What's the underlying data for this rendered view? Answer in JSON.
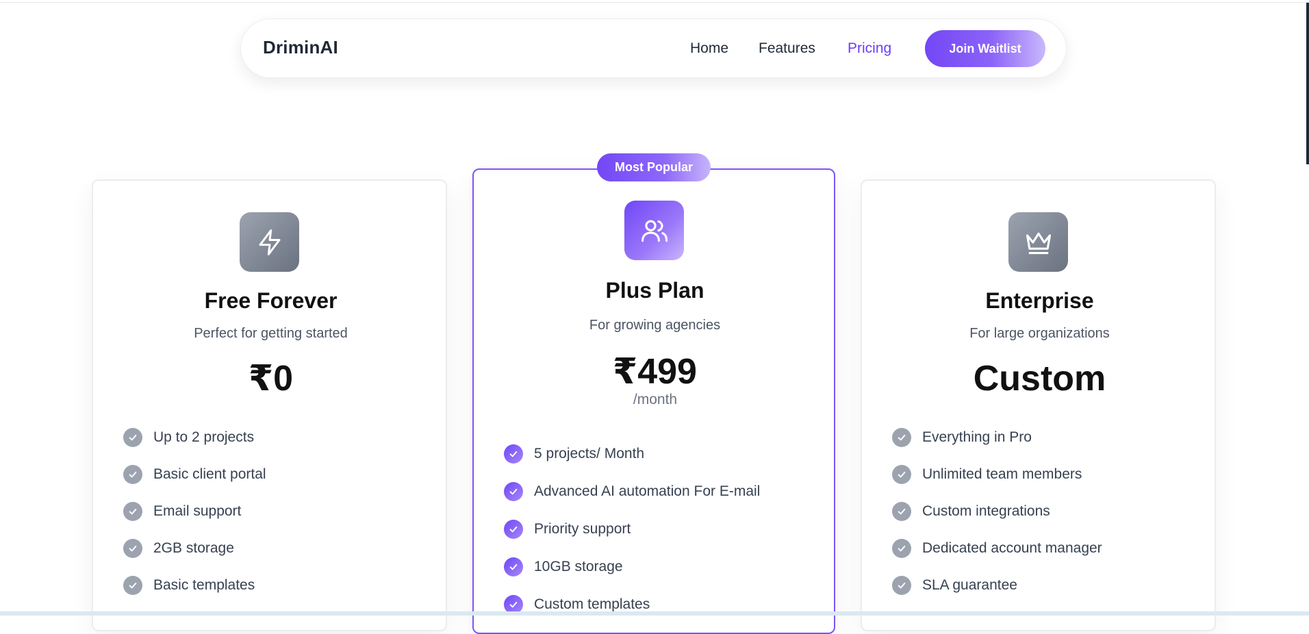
{
  "colors": {
    "accent": "#6d3df5",
    "accent_light": "#c9b8fb",
    "gray_icon": "#6b7280",
    "check_gray": "#9ca3af"
  },
  "nav": {
    "brand": "DriminAI",
    "links": [
      "Home",
      "Features",
      "Pricing"
    ],
    "active_link": "Pricing",
    "cta_label": "Join Waitlist"
  },
  "plans": [
    {
      "icon": "lightning-icon",
      "title": "Free Forever",
      "subtitle": "Perfect for getting started",
      "price": "₹0",
      "features": [
        "Up to 2 projects",
        "Basic client portal",
        "Email support",
        "2GB storage",
        "Basic templates"
      ]
    },
    {
      "badge": "Most Popular",
      "icon": "users-icon",
      "title": "Plus Plan",
      "subtitle": "For growing agencies",
      "price": "₹499",
      "period": "/month",
      "features": [
        "5 projects/ Month",
        "Advanced AI automation For E-mail",
        "Priority support",
        "10GB storage",
        "Custom templates"
      ]
    },
    {
      "icon": "crown-icon",
      "title": "Enterprise",
      "subtitle": "For large organizations",
      "price": "Custom",
      "features": [
        "Everything in Pro",
        "Unlimited team members",
        "Custom integrations",
        "Dedicated account manager",
        "SLA guarantee"
      ]
    }
  ]
}
